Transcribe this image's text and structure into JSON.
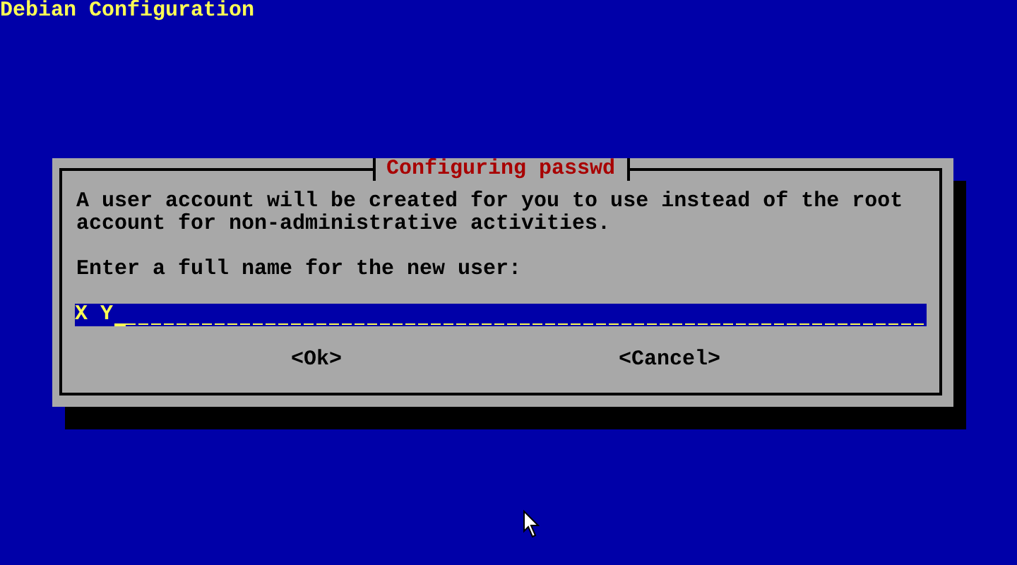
{
  "screen": {
    "title": "Debian Configuration"
  },
  "dialog": {
    "title": "Configuring passwd",
    "message": "A user account will be created for you to use instead of the root account for non-administrative activities.",
    "prompt": "Enter a full name for the new user:",
    "field": {
      "value": "X Y"
    },
    "buttons": [
      {
        "label": "<Ok>"
      },
      {
        "label": "<Cancel>"
      }
    ]
  }
}
